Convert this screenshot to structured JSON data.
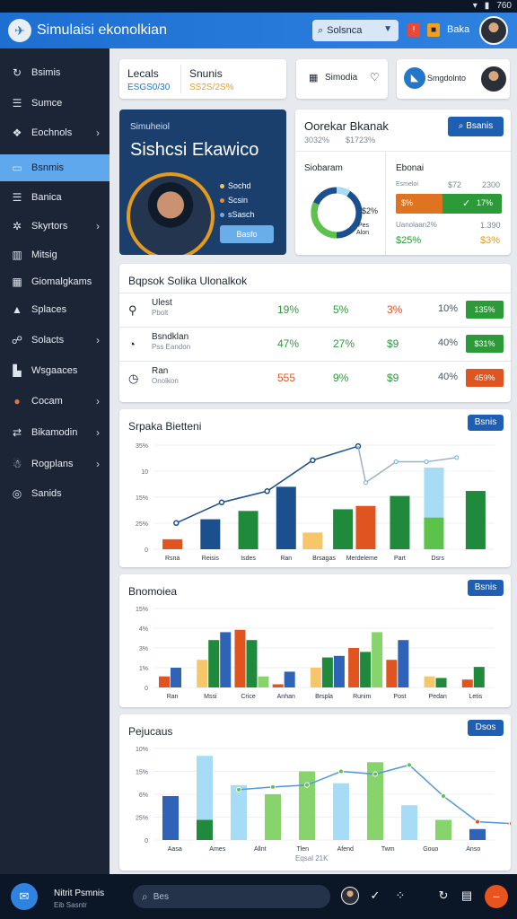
{
  "status": {
    "time_right": "760"
  },
  "header": {
    "app_title": "Simulaisi ekonolkian",
    "account_select": {
      "value": "Solsnca",
      "icon": "search-icon"
    },
    "header_label": "Baka"
  },
  "sidebar": {
    "items": [
      {
        "label": "Bsimis",
        "icon": "refresh-icon",
        "chevron": false
      },
      {
        "label": "Sumce",
        "icon": "list-icon",
        "chevron": false
      },
      {
        "label": "Eochnols",
        "icon": "team-icon",
        "chevron": true
      },
      {
        "label": "Bsnmis",
        "icon": "board-icon",
        "chevron": false,
        "active": true
      },
      {
        "label": "Banica",
        "icon": "list-icon",
        "chevron": false
      },
      {
        "label": "Skyrtors",
        "icon": "gear-icon",
        "chevron": true
      },
      {
        "label": "Mitsig",
        "icon": "building-icon",
        "chevron": false
      },
      {
        "label": "Giomalgkams",
        "icon": "chart-icon",
        "chevron": false
      },
      {
        "label": "Splaces",
        "icon": "doc-icon",
        "chevron": false
      },
      {
        "label": "Solacts",
        "icon": "users-icon",
        "chevron": true
      },
      {
        "label": "Wsgaaces",
        "icon": "book-icon",
        "chevron": false
      },
      {
        "label": "Cocam",
        "icon": "circle-icon",
        "chevron": true
      },
      {
        "label": "Bikamodin",
        "icon": "flow-icon",
        "chevron": true
      },
      {
        "label": "Rogplans",
        "icon": "people-icon",
        "chevron": true
      },
      {
        "label": "Sanids",
        "icon": "target-icon",
        "chevron": false
      }
    ]
  },
  "summary": {
    "left": {
      "label": "Lecals",
      "value": "ESGS0/30"
    },
    "mid": {
      "label": "Snunis",
      "value": "SS2S/2S%"
    },
    "right": {
      "label": "Simodia"
    },
    "profile": {
      "label": "Smgdolnto"
    }
  },
  "hero": {
    "small": "Simuheiol",
    "big": "Sishcsi Ekawico",
    "lines": [
      "Sochd",
      "Scsin",
      "sSasch"
    ],
    "button": "Basfo"
  },
  "overview": {
    "title": "Oorekar Bkanak",
    "subtitle_a": "3032%",
    "subtitle_b": "$1723%",
    "button": "Bsanis",
    "donut_title": "Siobaram",
    "donut_value": "$2%",
    "donut_sub": "Pes",
    "donut_sub2": "Alon",
    "bars_title": "Ebonai",
    "bars_head": [
      "Esmeloi",
      "$72",
      "2300"
    ],
    "bar_rows": [
      {
        "left": "$%",
        "right": "17%"
      }
    ],
    "bars_sub": [
      "Uanolaan2%",
      "1.390"
    ],
    "bars_foot": [
      "$25%",
      "$3%"
    ]
  },
  "table": {
    "title": "Bqpsok Solika Ulonalkok",
    "rows": [
      {
        "name": "Ulest",
        "sub": "Pbolt",
        "icon": "pin-icon",
        "c1": "19%",
        "c2": "5%",
        "c3": "3%",
        "c4": "10%",
        "pill": "135%",
        "pill_color": "#2d9a3a"
      },
      {
        "name": "Bsndklan",
        "sub": "Pss Eandon",
        "icon": "gauge-icon",
        "c1": "47%",
        "c2": "27%",
        "c3": "$9",
        "c4": "40%",
        "pill": "$31%",
        "pill_color": "#2d9a3a"
      },
      {
        "name": "Ran",
        "sub": "Onolkon",
        "icon": "clock-icon",
        "c1": "555",
        "c2": "9%",
        "c3": "$9",
        "c4": "40%",
        "pill": "459%",
        "pill_color": "#e0541f"
      }
    ]
  },
  "charts": {
    "c1_title": "Srpaka Bietteni",
    "c1_button": "Bsnis",
    "c2_title": "Bnomoiea",
    "c2_button": "Bsnis",
    "c3_title": "Pejucaus",
    "c3_button": "Dsos",
    "c3_footer": "Eqsal 21K"
  },
  "bottom": {
    "user": "Nitrit Psmnis",
    "user_sub": "Eib Sasntr",
    "search_placeholder": "Bes"
  },
  "chart_data": [
    {
      "type": "bar",
      "title": "Srpaka Bietteni",
      "yticks": [
        "35%",
        "10",
        "15%",
        "25%",
        "0"
      ],
      "categories": [
        "Rsna",
        "Reisis",
        "Isdes",
        "Ran",
        "Brsagas",
        "Merdeleme",
        "Part",
        "Dsrs"
      ],
      "bars": [
        {
          "cat": 0,
          "v": 0.12,
          "color": "#e0541f"
        },
        {
          "cat": 1,
          "v": 0.36,
          "color": "#1b4f8e"
        },
        {
          "cat": 2,
          "v": 0.46,
          "color": "#1f8a3c"
        },
        {
          "cat": 3,
          "v": 0.75,
          "color": "#1b4f8e"
        },
        {
          "cat": 3.7,
          "v": 0.2,
          "color": "#f5c66a"
        },
        {
          "cat": 4.5,
          "v": 0.48,
          "color": "#1f8a3c"
        },
        {
          "cat": 5.1,
          "v": 0.52,
          "color": "#e0541f"
        },
        {
          "cat": 6,
          "v": 0.64,
          "color": "#1f8a3c"
        },
        {
          "cat": 6.9,
          "v": 0.98,
          "color": "#a6dcf5"
        },
        {
          "cat": 6.9,
          "v": 0.38,
          "color": "#5cc24a"
        },
        {
          "cat": 8,
          "v": 0.7,
          "color": "#1f8a3c"
        }
      ],
      "line_dark": [
        0.28,
        0.5,
        0.62,
        0.95,
        1.1
      ],
      "line_light": [
        1.02,
        0.8,
        1.05,
        1.05,
        1.1
      ]
    },
    {
      "type": "bar",
      "title": "Bnomoiea",
      "yticks": [
        "15%",
        "4%",
        "3%",
        "1%",
        "0"
      ],
      "categories": [
        "Ran",
        "Mssi",
        "Crice",
        "Anhan",
        "Brspla",
        "Runim",
        "Post",
        "Pedan",
        "Letis"
      ],
      "groups": [
        [
          0.14,
          0.25,
          0
        ],
        [
          0.35,
          0.6,
          0.7
        ],
        [
          0.73,
          0.6,
          0.14
        ],
        [
          0.04,
          0.2,
          0
        ],
        [
          0.25,
          0.38,
          0.4
        ],
        [
          0.5,
          0.45,
          0.7
        ],
        [
          0.35,
          0.6,
          0
        ],
        [
          0.14,
          0.12,
          0
        ],
        [
          0.1,
          0.26,
          0
        ]
      ]
    },
    {
      "type": "bar",
      "title": "Pejucaus",
      "yticks": [
        "10%",
        "15%",
        "6%",
        "25%",
        "0"
      ],
      "categories": [
        "Aasa",
        "Ames",
        "Allnt",
        "Tlen",
        "Afend",
        "Twm",
        "Gouo",
        "Anso"
      ],
      "bars": [
        {
          "cat": 0,
          "v": 0.48,
          "color": "#2e63b7"
        },
        {
          "cat": 1,
          "v": 0.92,
          "color": "#a6dcf5"
        },
        {
          "cat": 1,
          "v": 0.22,
          "color": "#1f8a3c"
        },
        {
          "cat": 2,
          "v": 0.6,
          "color": "#a6dcf5"
        },
        {
          "cat": 3,
          "v": 0.5,
          "color": "#86d46b"
        },
        {
          "cat": 4,
          "v": 0.75,
          "color": "#86d46b"
        },
        {
          "cat": 5,
          "v": 0.62,
          "color": "#a6dcf5"
        },
        {
          "cat": 6,
          "v": 0.85,
          "color": "#86d46b"
        },
        {
          "cat": 7,
          "v": 0.38,
          "color": "#a6dcf5"
        },
        {
          "cat": 8,
          "v": 0.22,
          "color": "#86d46b"
        },
        {
          "cat": 9,
          "v": 0.12,
          "color": "#2e63b7"
        }
      ],
      "line": [
        0.55,
        0.58,
        0.6,
        0.75,
        0.72,
        0.82,
        0.48,
        0.2,
        0.18
      ]
    }
  ],
  "colors": {
    "accent": "#1e5fb3",
    "sidebar": "#1b2536",
    "active": "#5fa8ee"
  }
}
